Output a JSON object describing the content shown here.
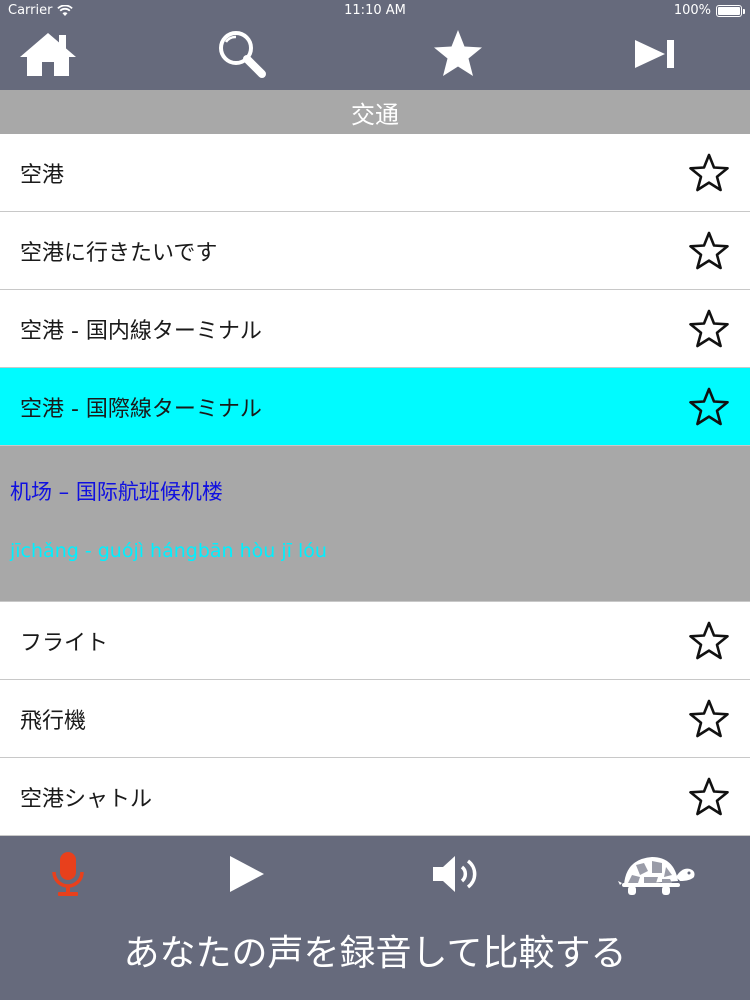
{
  "status_bar": {
    "carrier": "Carrier",
    "time": "11:10 AM",
    "battery": "100%"
  },
  "toolbar": {
    "buttons": [
      "home-icon",
      "search-icon",
      "star-icon",
      "skip-forward-icon"
    ]
  },
  "section": {
    "title": "交通"
  },
  "list": {
    "items": [
      {
        "label": "空港"
      },
      {
        "label": "空港に行きたいです"
      },
      {
        "label": "空港 - 国内線ターミナル"
      },
      {
        "label": "空港 - 国際線ターミナル"
      }
    ],
    "detail": {
      "chinese": "机场 – 国际航班候机楼",
      "pinyin": "jīchǎng - guójì hángbān hòu jī lóu"
    },
    "items_after": [
      {
        "label": "フライト"
      },
      {
        "label": "飛行機"
      },
      {
        "label": "空港シャトル"
      }
    ]
  },
  "bottom_bar": {
    "buttons": [
      "microphone-icon",
      "play-icon",
      "speaker-icon",
      "turtle-icon"
    ],
    "hint": "あなたの声を録音して比較する"
  },
  "colors": {
    "bar_bg": "#666a7c",
    "section_bg": "#a8a8a8",
    "selected_row": "#00fbff",
    "chinese_text": "#1010e0",
    "pinyin_text": "#00f0ff",
    "mic_red": "#e8401c"
  }
}
